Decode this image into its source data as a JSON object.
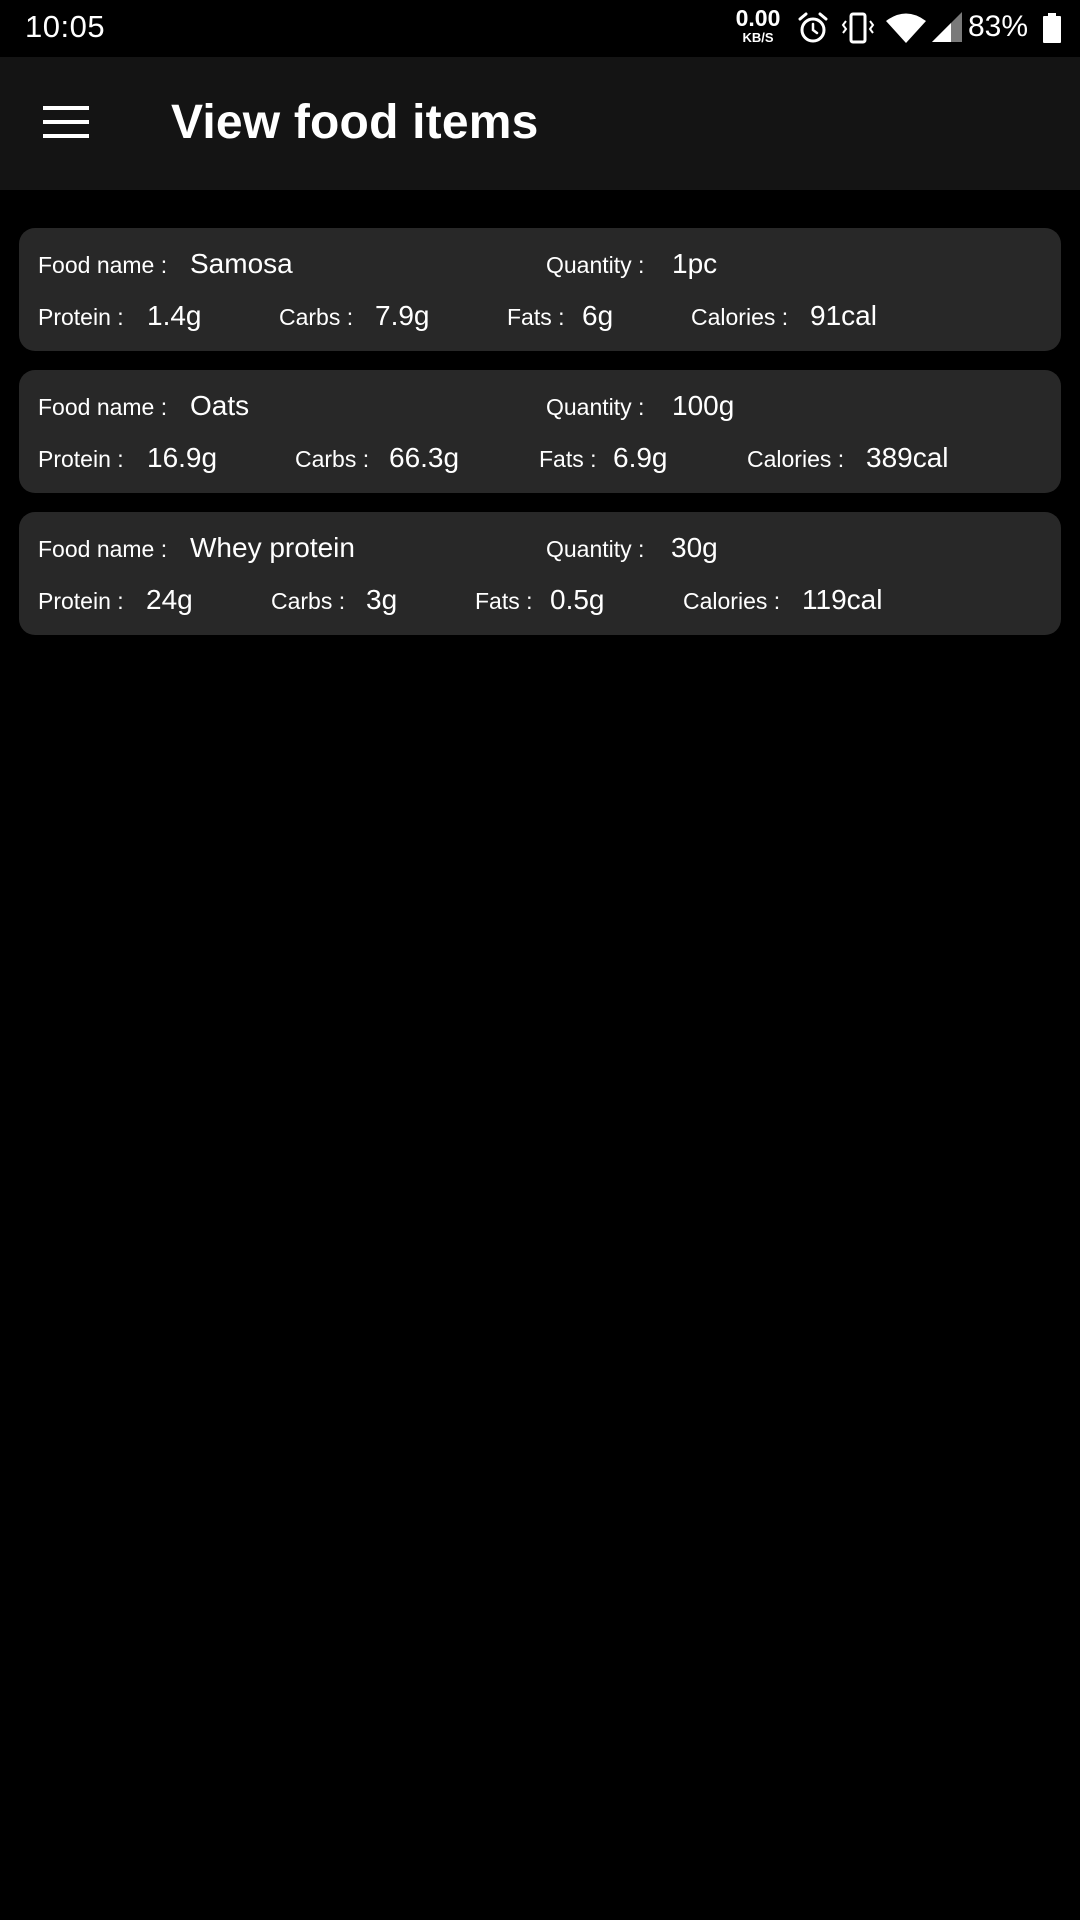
{
  "status_bar": {
    "time": "10:05",
    "net_speed": "0.00",
    "net_unit": "KB/S",
    "battery": "83%",
    "icons": [
      "alarm-icon",
      "vibrate-icon",
      "wifi-icon",
      "signal-icon",
      "battery-icon"
    ]
  },
  "app_bar": {
    "title": "View food items",
    "menu_icon": "hamburger-menu-icon"
  },
  "labels": {
    "food_name": "Food name :",
    "quantity": "Quantity :",
    "protein": "Protein :",
    "carbs": "Carbs :",
    "fats": "Fats :",
    "calories": "Calories :"
  },
  "food_items": [
    {
      "name": "Samosa",
      "quantity": "1pc",
      "protein": "1.4g",
      "carbs": "7.9g",
      "fats": "6g",
      "calories": "91cal"
    },
    {
      "name": "Oats",
      "quantity": "100g",
      "protein": "16.9g",
      "carbs": "66.3g",
      "fats": "6.9g",
      "calories": "389cal"
    },
    {
      "name": "Whey protein",
      "quantity": "30g",
      "protein": "24g",
      "carbs": "3g",
      "fats": "0.5g",
      "calories": "119cal"
    }
  ],
  "colors": {
    "background": "#000000",
    "app_bar": "#141414",
    "card": "#282828",
    "text": "#ffffff"
  }
}
